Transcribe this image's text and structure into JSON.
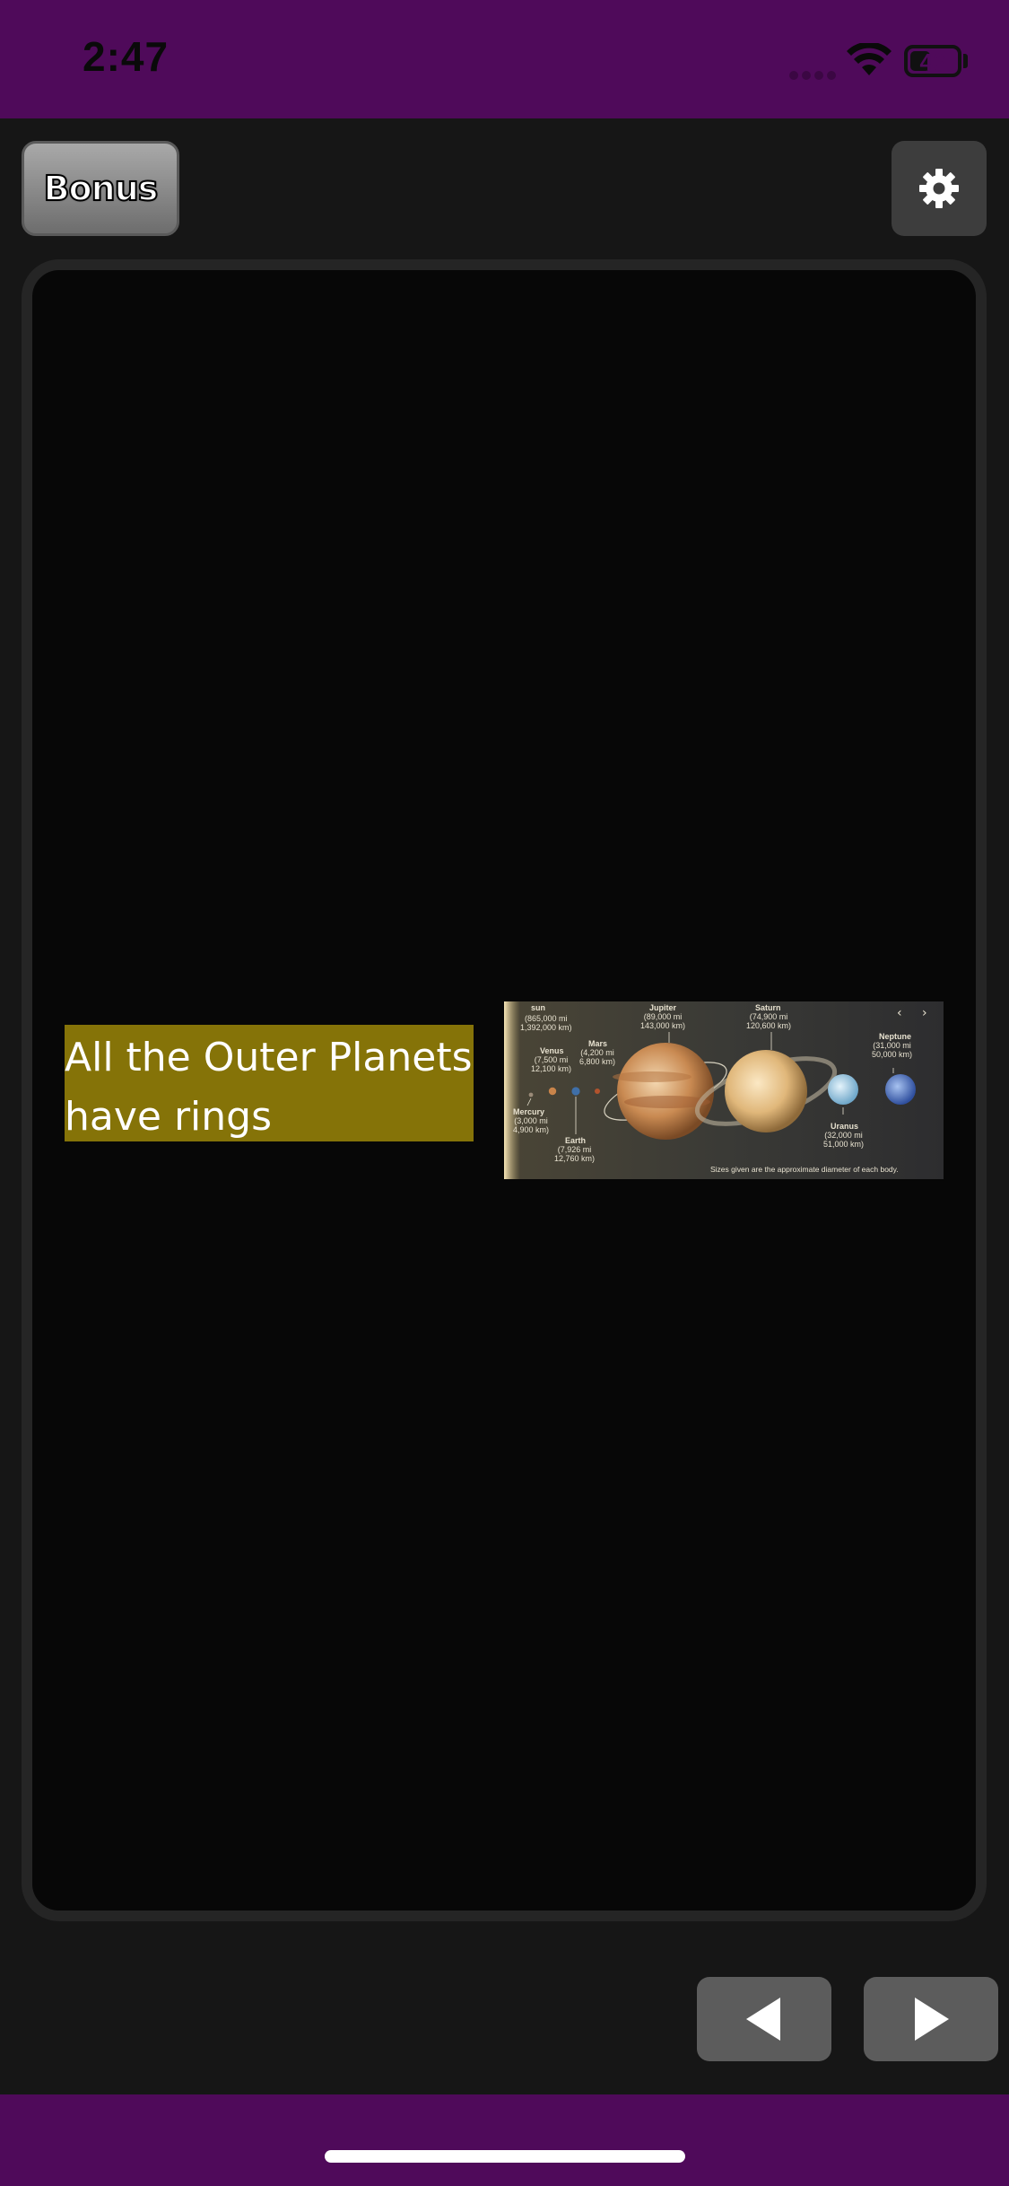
{
  "status_bar": {
    "time": "2:47",
    "battery_level": "43",
    "battery_fraction": 0.43,
    "icons": [
      "signal-icon",
      "wifi-icon",
      "battery-icon"
    ]
  },
  "toolbar": {
    "bonus_label": "Bonus",
    "settings_icon": "gear-icon"
  },
  "card": {
    "statement_line1": "All the Outer Planets",
    "statement_line2": "have rings",
    "image": {
      "labels": {
        "sun": "sun",
        "sun_size": "(865,000 mi\n1,392,000 km)",
        "venus": "Venus",
        "venus_size": "(7,500 mi\n12,100 km)",
        "mars": "Mars",
        "mars_size": "(4,200 mi\n6,800 km)",
        "mercury": "Mercury",
        "mercury_size": "(3,000 mi\n4,900 km)",
        "earth": "Earth",
        "earth_size": "(7,926 mi\n12,760 km)",
        "jupiter": "Jupiter",
        "jupiter_size": "(89,000 mi\n143,000 km)",
        "saturn": "Saturn",
        "saturn_size": "(74,900 mi\n120,600 km)",
        "uranus": "Uranus",
        "uranus_size": "(32,000 mi\n51,000 km)",
        "neptune": "Neptune",
        "neptune_size": "(31,000 mi\n50,000 km)",
        "caption": "Sizes given are the approximate diameter of each body."
      }
    }
  },
  "nav": {
    "prev_icon": "triangle-left-icon",
    "next_icon": "triangle-right-icon"
  },
  "colors": {
    "system_bar": "#4f0a5a",
    "background": "#161616",
    "card_bg": "#070707",
    "statement_highlight": "#857308",
    "button_gray": "#5c5c5c"
  }
}
